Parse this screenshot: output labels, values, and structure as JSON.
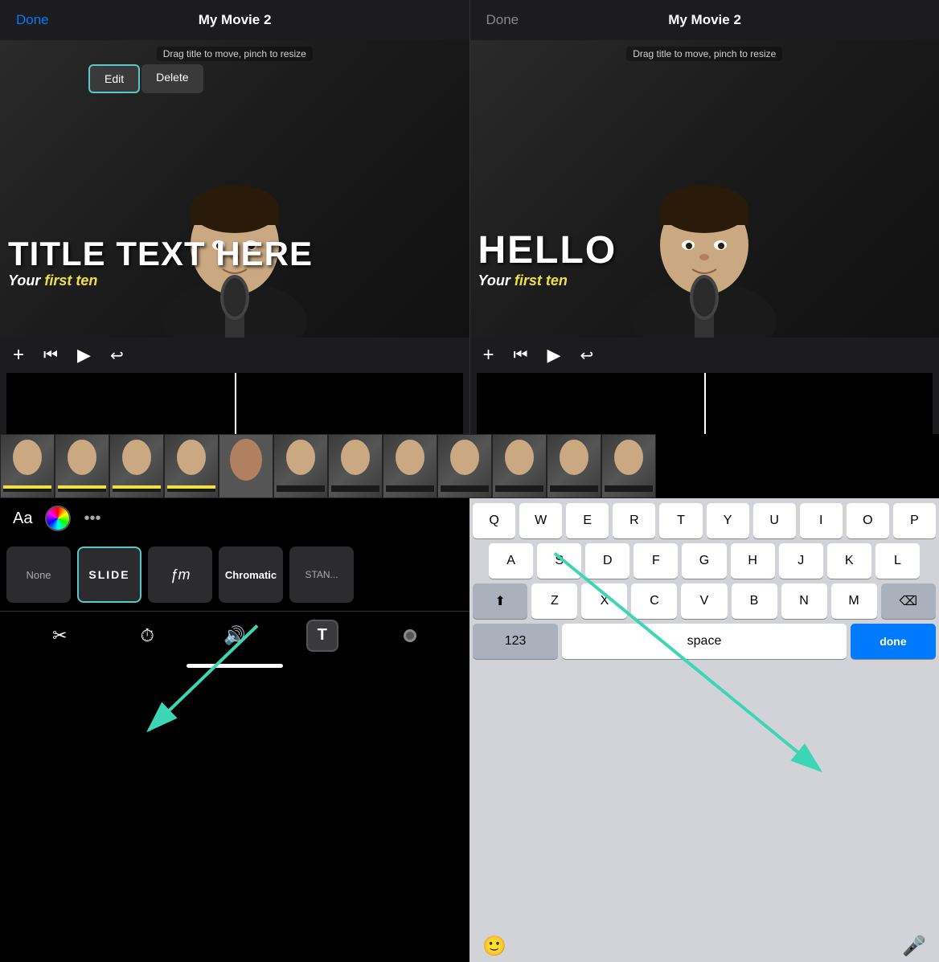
{
  "left_panel": {
    "done": "Done",
    "title": "My Movie 2",
    "drag_hint": "Drag title to move, pinch to resize",
    "edit_btn": "Edit",
    "delete_btn": "Delete",
    "title_text": "TITLE TEXT HERE",
    "subtitle": "Your ",
    "subtitle_highlight": "first ten",
    "controls": {
      "add": "+",
      "rewind": "⏮",
      "play": "▶",
      "undo": "↩"
    }
  },
  "right_panel": {
    "done": "Done",
    "title": "My Movie 2",
    "drag_hint": "Drag title to move, pinch to resize",
    "title_text": "HELLO",
    "subtitle": "Your ",
    "subtitle_highlight": "first ten",
    "controls": {
      "add": "+",
      "rewind": "⏮",
      "play": "▶",
      "undo": "↩"
    }
  },
  "text_style": {
    "aa_label": "Aa",
    "more_label": "•••",
    "styles": [
      {
        "id": "none",
        "label": "None"
      },
      {
        "id": "slide",
        "label": "SLIDE",
        "selected": true
      },
      {
        "id": "script",
        "label": "ƒm"
      },
      {
        "id": "chromatic",
        "label": "Chromatic"
      },
      {
        "id": "standard",
        "label": "STAN..."
      }
    ]
  },
  "edit_tools": [
    {
      "id": "scissors",
      "symbol": "✂",
      "label": "scissors"
    },
    {
      "id": "speed",
      "symbol": "⏱",
      "label": "speed"
    },
    {
      "id": "volume",
      "symbol": "🔊",
      "label": "volume"
    },
    {
      "id": "text",
      "symbol": "T",
      "label": "text",
      "active": true
    },
    {
      "id": "more",
      "symbol": "⬤",
      "label": "more"
    }
  ],
  "keyboard": {
    "rows": [
      [
        "Q",
        "W",
        "E",
        "R",
        "T",
        "Y",
        "U",
        "I",
        "O",
        "P"
      ],
      [
        "A",
        "S",
        "D",
        "F",
        "G",
        "H",
        "J",
        "K",
        "L"
      ],
      [
        "Z",
        "X",
        "C",
        "V",
        "B",
        "N",
        "M"
      ]
    ],
    "num_label": "123",
    "space_label": "space",
    "done_label": "done"
  }
}
